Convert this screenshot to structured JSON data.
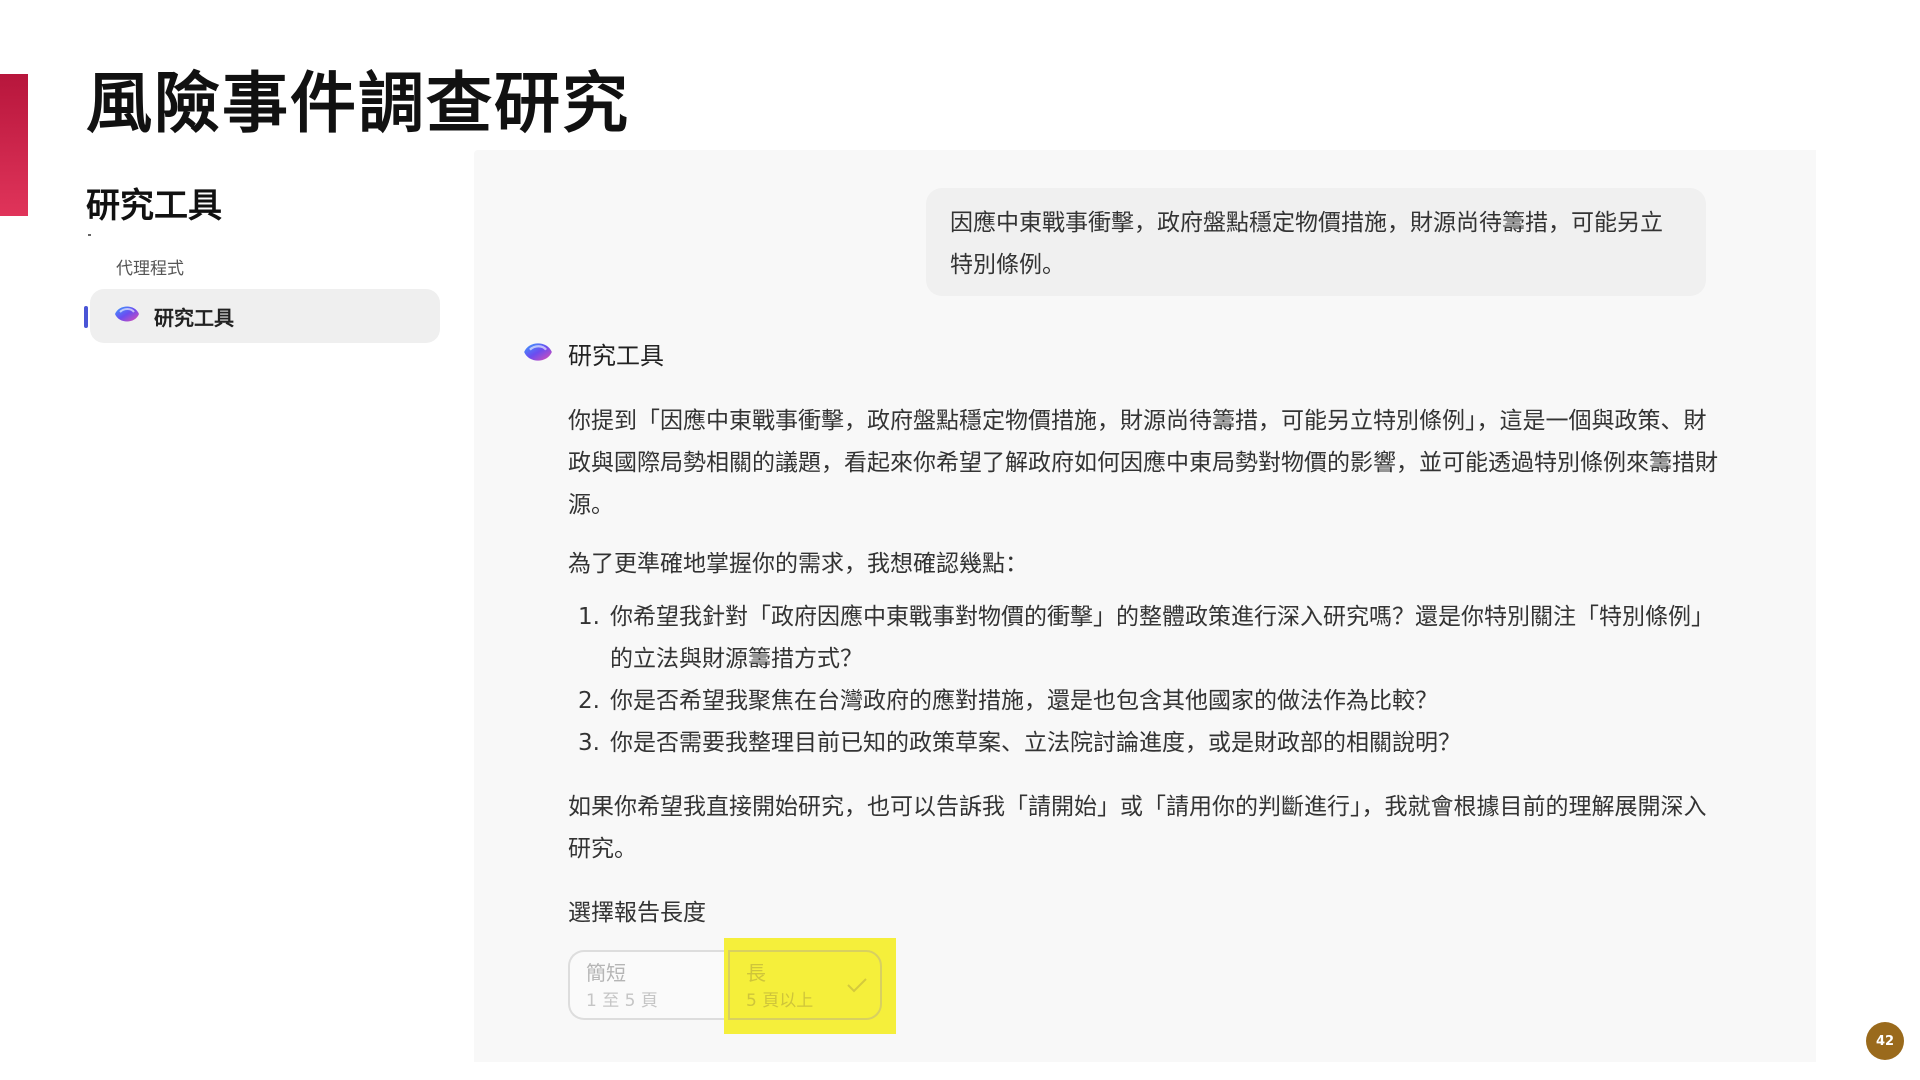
{
  "slide": {
    "title": "風險事件調查研究",
    "section_title": "研究工具",
    "page_number": "42"
  },
  "sidebar": {
    "section_label": "代理程式",
    "items": [
      {
        "label": "研究工具",
        "icon": "copilot-orb-icon",
        "active": true
      }
    ]
  },
  "chat": {
    "user_message": "因應中東戰事衝擊，政府盤點穩定物價措施，財源尚待籌措，可能另立特別條例。",
    "assistant_name": "研究工具",
    "paragraphs": [
      "你提到「因應中東戰事衝擊，政府盤點穩定物價措施，財源尚待籌措，可能另立特別條例」，這是一個與政策、財政與國際局勢相關的議題，看起來你希望了解政府如何因應中東局勢對物價的影響，並可能透過特別條例來籌措財源。",
      "為了更準確地掌握你的需求，我想確認幾點："
    ],
    "questions": [
      {
        "num": "1.",
        "text": "你希望我針對「政府因應中東戰事對物價的衝擊」的整體政策進行深入研究嗎？還是你特別關注「特別條例」的立法與財源籌措方式？"
      },
      {
        "num": "2.",
        "text": "你是否希望我聚焦在台灣政府的應對措施，還是也包含其他國家的做法作為比較？"
      },
      {
        "num": "3.",
        "text": "你是否需要我整理目前已知的政策草案、立法院討論進度，或是財政部的相關說明？"
      }
    ],
    "closing": "如果你希望我直接開始研究，也可以告訴我「請開始」或「請用你的判斷進行」，我就會根據目前的理解展開深入研究。",
    "report_length": {
      "label": "選擇報告長度",
      "options": [
        {
          "title": "簡短",
          "subtitle": "1 至 5 頁",
          "selected": false
        },
        {
          "title": "長",
          "subtitle": "5 頁以上",
          "selected": true
        }
      ]
    }
  },
  "colors": {
    "accent": "#c81f47",
    "highlight": "#f5ef3b",
    "page_badge": "#9a6a1c"
  }
}
